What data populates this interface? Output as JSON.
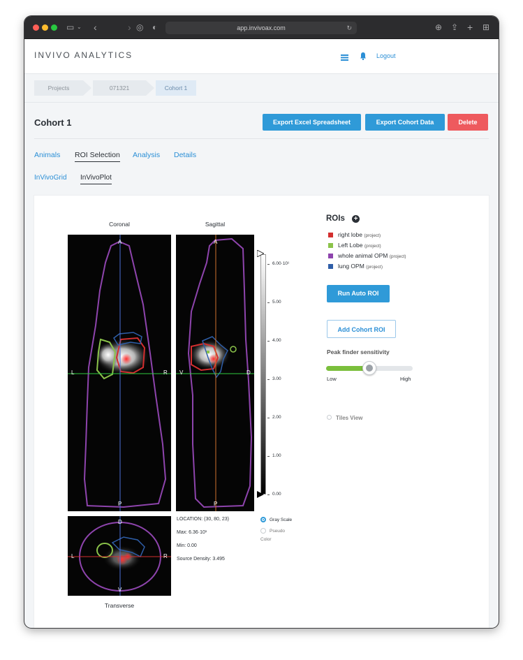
{
  "browser": {
    "url": "app.invivoax.com"
  },
  "app": {
    "brand": "INVIVO ANALYTICS",
    "logout": "Logout"
  },
  "breadcrumbs": [
    "Projects",
    "071321",
    "Cohort 1"
  ],
  "page": {
    "title": "Cohort 1",
    "buttons": {
      "export_excel": "Export Excel Spreadsheet",
      "export_cohort": "Export Cohort Data",
      "delete": "Delete"
    }
  },
  "tabs": [
    "Animals",
    "ROI Selection",
    "Analysis",
    "Details"
  ],
  "active_tab": "ROI Selection",
  "subtabs": [
    "InVivoGrid",
    "InVivoPlot"
  ],
  "active_subtab": "InVivoPlot",
  "viewer": {
    "coronal_title": "Coronal",
    "sagittal_title": "Sagittal",
    "transverse_title": "Transverse",
    "coronal_markers": {
      "top": "A",
      "bottom": "P",
      "left": "L",
      "right": "R"
    },
    "sagittal_markers": {
      "top": "A",
      "bottom": "P",
      "left": "V",
      "right": "D"
    },
    "transverse_markers": {
      "top": "D",
      "bottom": "V",
      "left": "L",
      "right": "R"
    },
    "colorbar_ticks": [
      "6.00·10¹",
      "5.00",
      "4.00",
      "3.00",
      "2.00",
      "1.00",
      "0.00"
    ],
    "info": {
      "location": "LOCATION: (30, 80, 23)",
      "max": "Max: 6.36·10¹",
      "min": "Min: 0.00",
      "source_density": "Source Density: 3.495"
    },
    "colormap": {
      "gray": "Gray Scale",
      "pseudo_line1": "Pseudo",
      "pseudo_line2": "Color",
      "selected": "Gray Scale"
    }
  },
  "rois": {
    "title": "ROIs",
    "items": [
      {
        "name": "right lobe",
        "tag": "(project)",
        "color": "#d32f2f"
      },
      {
        "name": "Left Lobe",
        "tag": "(project)",
        "color": "#8bc34a"
      },
      {
        "name": "whole animal OPM",
        "tag": "(project)",
        "color": "#8e44ad"
      },
      {
        "name": "lung OPM",
        "tag": "(project)",
        "color": "#2f5ea8"
      }
    ],
    "run_auto": "Run Auto ROI",
    "add_cohort": "Add Cohort ROI",
    "peak_label": "Peak finder sensitivity",
    "low": "Low",
    "high": "High",
    "sensitivity": 0.5,
    "tiles_view": "Tiles View"
  },
  "colors": {
    "accent": "#2f9ad8",
    "danger": "#ee5a5e",
    "link": "#2b8fd6"
  }
}
